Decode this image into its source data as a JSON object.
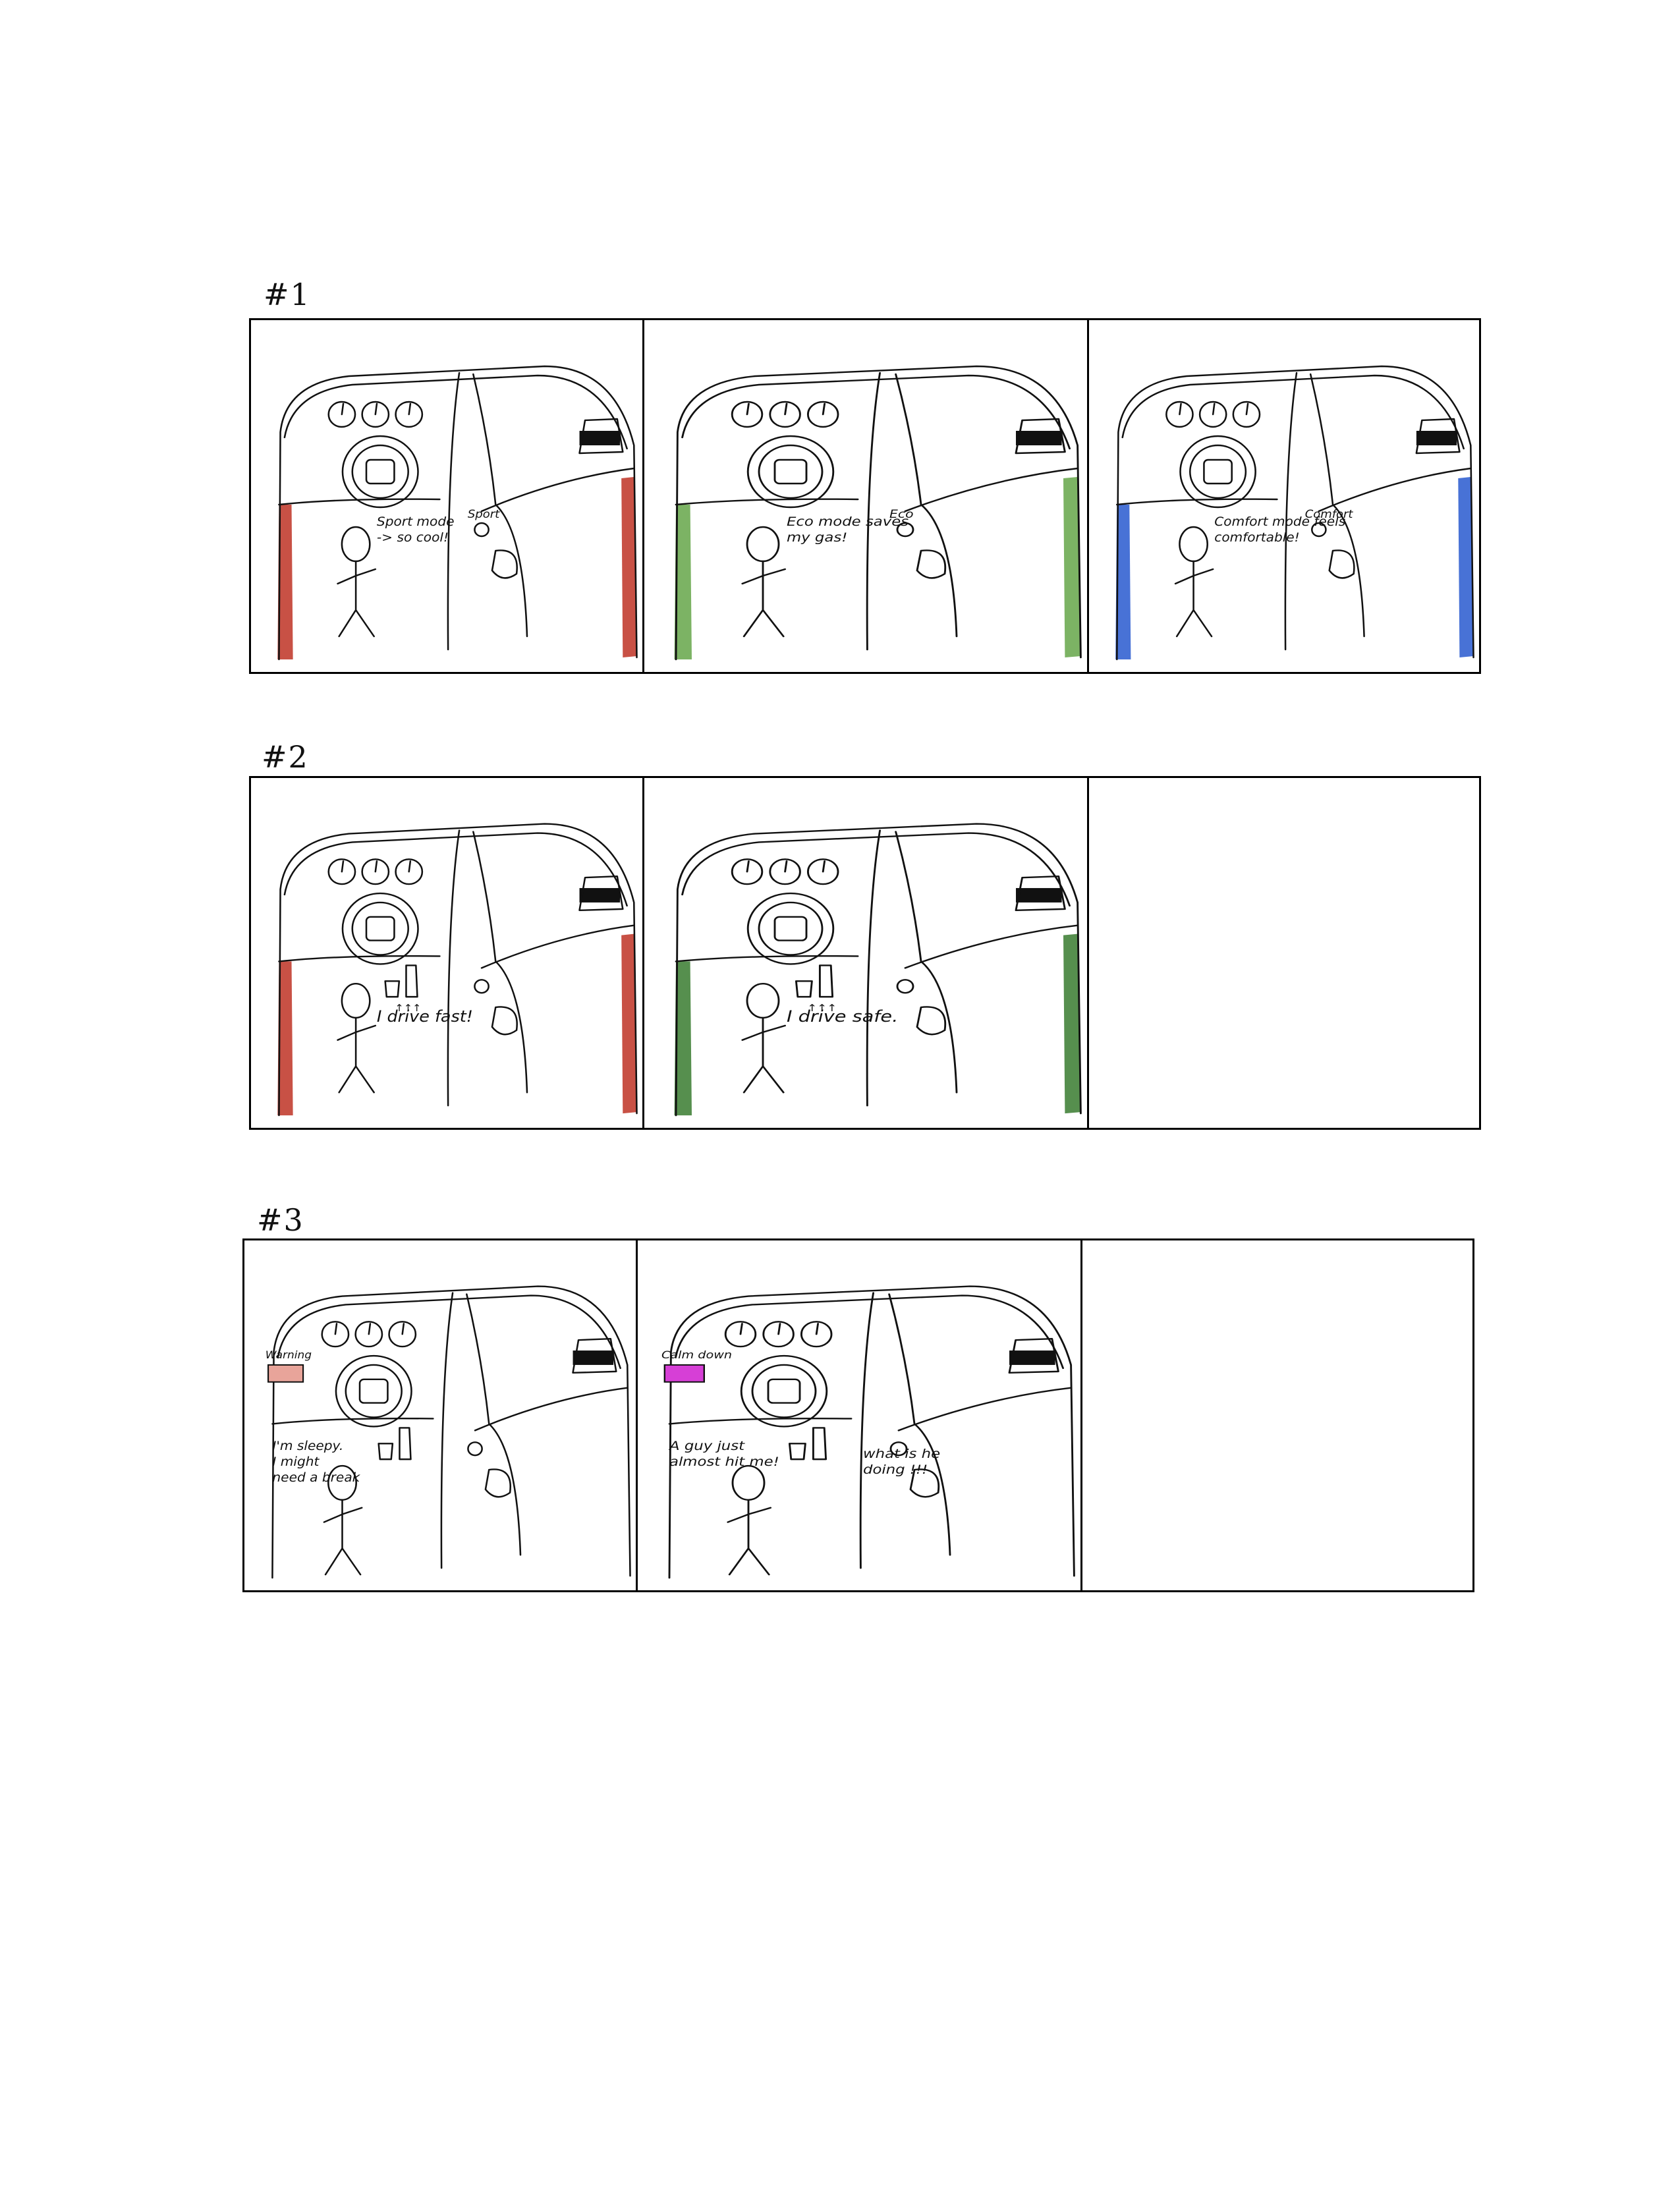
{
  "rows": [
    {
      "label": "#1",
      "panels": [
        {
          "accent": "#c0392b",
          "mode_label": "Sport",
          "mode_color": "#c0392b",
          "speech": [
            "Sport mode",
            "-> so cool!"
          ],
          "speech_color": "#111111",
          "pedals": false,
          "pedal_marks": "",
          "alert": null,
          "alert_lines": []
        },
        {
          "accent": "#6aa84f",
          "mode_label": "Eco",
          "mode_color": "#4f8f2f",
          "speech": [
            "Eco mode saves",
            "my gas!"
          ],
          "speech_color": "#111111",
          "pedals": false,
          "pedal_marks": "",
          "alert": null,
          "alert_lines": []
        },
        {
          "accent": "#2f5fd0",
          "mode_label": "Comfort",
          "mode_color": "#2f5fd0",
          "speech": [
            "Comfort mode feels",
            "comfortable!"
          ],
          "speech_color": "#111111",
          "pedals": false,
          "pedal_marks": "",
          "alert": null,
          "alert_lines": []
        }
      ]
    },
    {
      "label": "#2",
      "panels": [
        {
          "accent": "#c0392b",
          "mode_label": "",
          "mode_color": "#c0392b",
          "speech": [
            "I drive fast!"
          ],
          "speech_color": "#c0392b",
          "pedals": true,
          "pedal_marks": "↑↑↑",
          "alert": null,
          "alert_lines": []
        },
        {
          "accent": "#3f7f35",
          "mode_label": "",
          "mode_color": "#3f7f35",
          "speech": [
            "I drive safe."
          ],
          "speech_color": "#3f7f35",
          "pedals": true,
          "pedal_marks": "↑↑↑",
          "alert": null,
          "alert_lines": []
        },
        null
      ]
    },
    {
      "label": "#3",
      "panels": [
        {
          "accent": null,
          "mode_label": "",
          "mode_color": "#c0392b",
          "speech": [
            "I'm sleepy.",
            "I might",
            "need a break"
          ],
          "speech_color": "#111111",
          "pedals": true,
          "pedal_marks": "",
          "alert": {
            "label": "Warning",
            "color": "#c0392b",
            "fill": "#e8a49a"
          },
          "alert_lines": []
        },
        {
          "accent": null,
          "mode_label": "",
          "mode_color": "#c000c0",
          "speech": [
            "A guy just",
            "almost hit me!"
          ],
          "speech_color": "#111111",
          "pedals": true,
          "pedal_marks": "",
          "alert": {
            "label": "Calm down",
            "color": "#c000c0",
            "fill": "#d63fd6"
          },
          "alert_lines": [
            "what is he",
            "doing !!!"
          ]
        },
        null
      ]
    }
  ]
}
